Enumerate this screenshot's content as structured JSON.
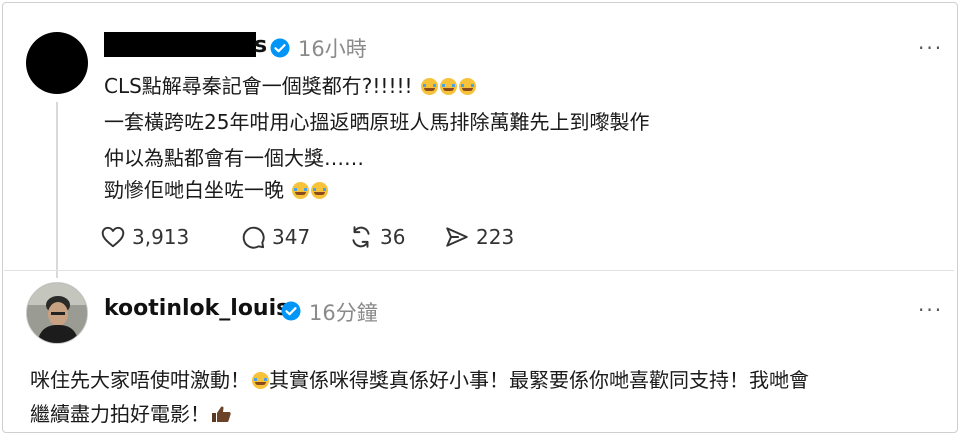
{
  "post": {
    "username_tail": "s",
    "time": "16小時",
    "more_label": "···",
    "lines": [
      "CLS點解尋秦記會一個獎都冇?!!!!! ",
      "一套橫跨咗25年咁用心搵返晒原班人馬排除萬難先上到嚟製作",
      "仲以為點都會有一個大獎……",
      "勁慘佢哋白坐咗一晚 "
    ],
    "stats": {
      "likes": "3,913",
      "comments": "347",
      "reposts": "36",
      "shares": "223"
    }
  },
  "reply": {
    "username": "kootinlok_louis",
    "time": "16分鐘",
    "more_label": "···",
    "line1a": "咪住先大家唔使咁激動！",
    "line1b": "其實係咪得獎真係好小事！最緊要係你哋喜歡同支持！我哋會",
    "line2": "繼續盡力拍好電影！"
  },
  "icons": {
    "verified": "verified-badge-icon",
    "like": "heart-icon",
    "comment": "comment-icon",
    "repost": "repost-icon",
    "share": "send-icon",
    "emoji_cry": "crying-laughing-emoji",
    "emoji_thumb": "thumbs-up-emoji"
  },
  "colors": {
    "verified_blue": "#0095f6",
    "meta_gray": "#8a8a8a"
  }
}
